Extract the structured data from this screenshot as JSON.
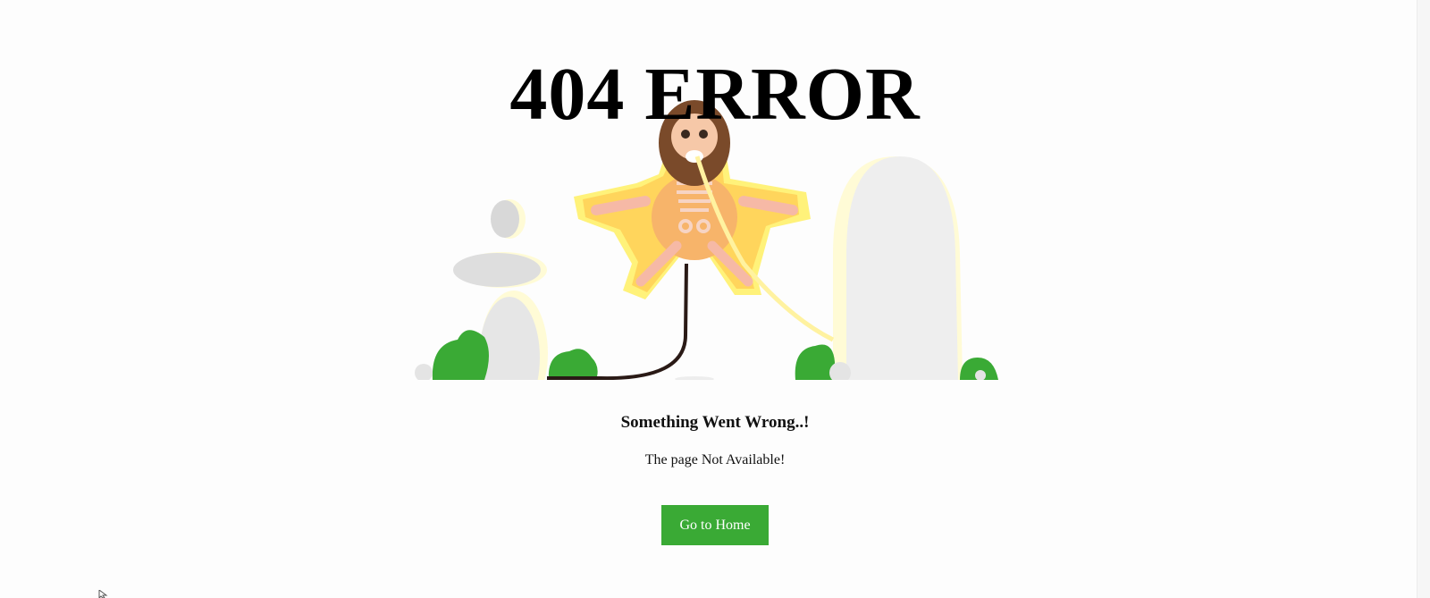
{
  "error": {
    "title": "404 ERROR",
    "heading": "Something Went Wrong..!",
    "message": "The page Not Available!"
  },
  "actions": {
    "home_label": "Go to Home"
  },
  "colors": {
    "button_bg": "#3aaa35",
    "button_text": "#ffffff",
    "bush_green": "#3aaa35",
    "rock_grey": "#e2e2e2",
    "glow_yellow": "#fff27a"
  },
  "icons": {
    "illustration": "electrocuted-skeleton-illustration",
    "cursor": "mouse-pointer-icon"
  }
}
